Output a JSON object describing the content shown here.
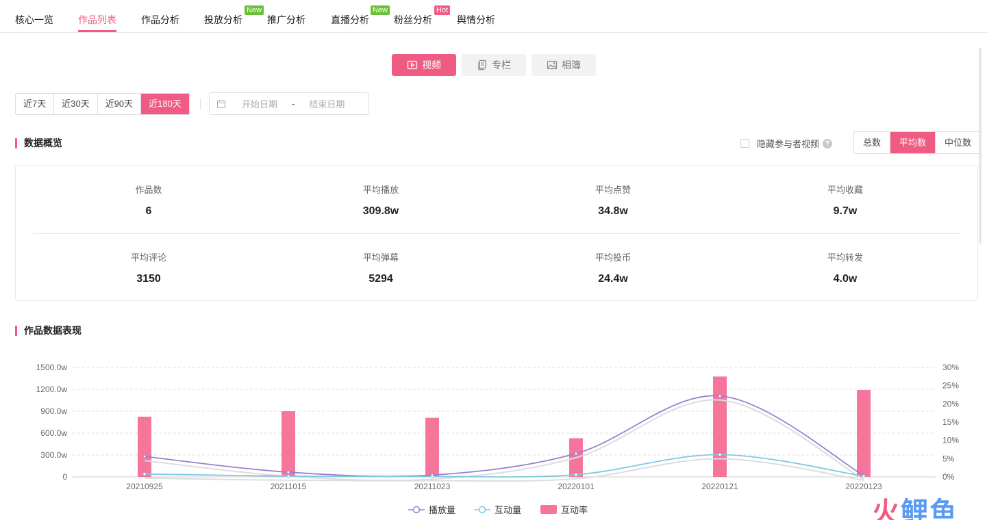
{
  "nav": {
    "tabs": [
      {
        "label": "核心一览"
      },
      {
        "label": "作品列表",
        "active": true
      },
      {
        "label": "作品分析"
      },
      {
        "label": "投放分析",
        "badge": "New"
      },
      {
        "label": "推广分析"
      },
      {
        "label": "直播分析",
        "badge": "New"
      },
      {
        "label": "粉丝分析",
        "badge": "Hot"
      },
      {
        "label": "舆情分析"
      }
    ]
  },
  "content_types": [
    {
      "label": "视频",
      "icon": "play-icon",
      "active": true
    },
    {
      "label": "专栏",
      "icon": "document-icon"
    },
    {
      "label": "相簿",
      "icon": "image-icon"
    }
  ],
  "date_ranges": [
    {
      "label": "近7天"
    },
    {
      "label": "近30天"
    },
    {
      "label": "近90天"
    },
    {
      "label": "近180天",
      "active": true
    }
  ],
  "date_picker": {
    "start_placeholder": "开始日期",
    "separator": "-",
    "end_placeholder": "结束日期"
  },
  "overview": {
    "title": "数据概览",
    "hide_option": "隐藏参与者视频",
    "help_icon": "?",
    "metric_modes": [
      {
        "label": "总数"
      },
      {
        "label": "平均数",
        "active": true
      },
      {
        "label": "中位数"
      }
    ],
    "stats": [
      {
        "label": "作品数",
        "value": "6"
      },
      {
        "label": "平均播放",
        "value": "309.8w"
      },
      {
        "label": "平均点赞",
        "value": "34.8w"
      },
      {
        "label": "平均收藏",
        "value": "9.7w"
      },
      {
        "label": "平均评论",
        "value": "3150"
      },
      {
        "label": "平均弹幕",
        "value": "5294"
      },
      {
        "label": "平均投币",
        "value": "24.4w"
      },
      {
        "label": "平均转发",
        "value": "4.0w"
      }
    ]
  },
  "performance": {
    "title": "作品数据表现"
  },
  "chart_data": {
    "type": "bar",
    "categories": [
      "20210925",
      "20211015",
      "20211023",
      "20220101",
      "20220121",
      "20220123"
    ],
    "y_left": {
      "ticks": [
        "0",
        "300.0w",
        "600.0w",
        "900.0w",
        "1200.0w",
        "1500.0w"
      ],
      "ylim": [
        0,
        1500
      ]
    },
    "y_right": {
      "ticks": [
        "0%",
        "5%",
        "10%",
        "15%",
        "20%",
        "25%",
        "30%"
      ],
      "ylim": [
        0,
        30
      ]
    },
    "grid": true,
    "series": [
      {
        "name": "播放量",
        "type": "line",
        "axis": "left",
        "color": "#9b7fd1",
        "values": [
          280,
          65,
          25,
          320,
          1110,
          20
        ]
      },
      {
        "name": "互动量",
        "type": "line",
        "axis": "left",
        "color": "#7ec8e3",
        "values": [
          40,
          10,
          5,
          30,
          305,
          10
        ]
      },
      {
        "name": "互动率",
        "type": "bar",
        "axis": "right",
        "color": "#f5769a",
        "values": [
          16.5,
          18,
          16.2,
          10.6,
          27.5,
          23.8
        ]
      }
    ],
    "legend_position": "bottom-center"
  },
  "watermark": {
    "part1": "火",
    "part2": "鲤",
    "part3": "鱼"
  }
}
